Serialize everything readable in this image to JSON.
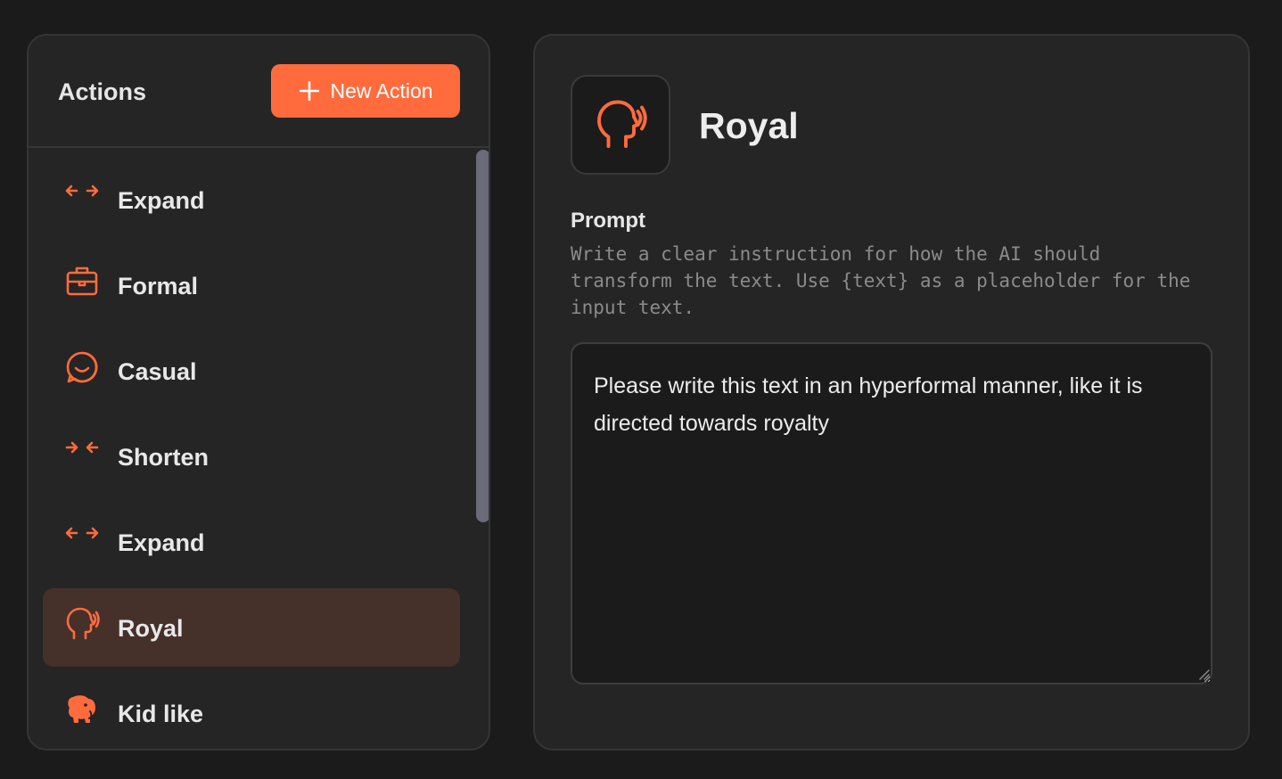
{
  "sidebar": {
    "title": "Actions",
    "new_action_label": "New Action",
    "items": [
      {
        "label": "Expand",
        "icon": "expand-arrows-icon",
        "active": false
      },
      {
        "label": "Formal",
        "icon": "briefcase-icon",
        "active": false
      },
      {
        "label": "Casual",
        "icon": "smiley-icon",
        "active": false
      },
      {
        "label": "Shorten",
        "icon": "shorten-arrows-icon",
        "active": false
      },
      {
        "label": "Expand",
        "icon": "expand-arrows-icon",
        "active": false
      },
      {
        "label": "Royal",
        "icon": "speaking-head-icon",
        "active": true
      },
      {
        "label": "Kid like",
        "icon": "elephant-icon",
        "active": false
      }
    ]
  },
  "detail": {
    "title": "Royal",
    "icon": "speaking-head-icon",
    "prompt_label": "Prompt",
    "prompt_help": "Write a clear instruction for how the AI should transform the text. Use {text} as a placeholder for the input text.",
    "prompt_value": "Please write this text in an hyperformal manner, like it is directed towards royalty"
  },
  "colors": {
    "accent": "#ff6b3d",
    "background": "#1b1b1b",
    "panel": "#252525",
    "active_item": "#45302a"
  }
}
